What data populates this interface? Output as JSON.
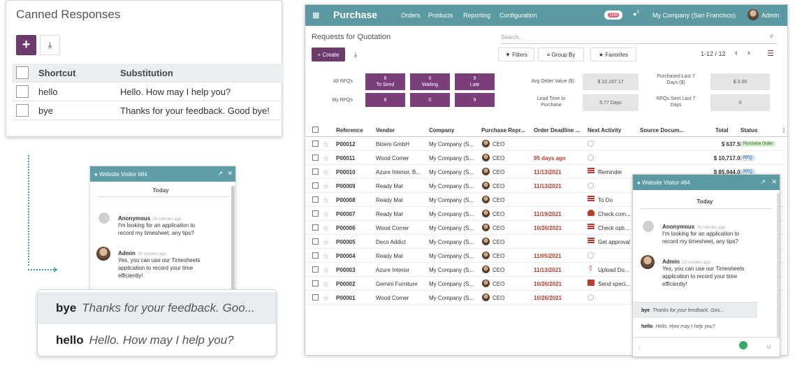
{
  "canned": {
    "title": "Canned Responses",
    "add_label": "+",
    "headers": [
      "Shortcut",
      "Substitution"
    ],
    "rows": [
      {
        "shortcut": "hello",
        "substitution": "Hello. How may I help you?"
      },
      {
        "shortcut": "bye",
        "substitution": "Thanks for your feedback. Good bye!"
      }
    ]
  },
  "left_chat": {
    "title": "Website Visitor #84",
    "today": "Today",
    "messages": [
      {
        "name": "Anonymous",
        "time": "26 minutes ago",
        "text": [
          "I'm looking for an application to",
          "record my timesheet, any tips?"
        ]
      },
      {
        "name": "Admin",
        "time": "26 minutes ago",
        "text": [
          "Yes, you can use our Timesheets",
          "application to record your time",
          "efficiently!"
        ]
      }
    ]
  },
  "left_suggestions": [
    {
      "shortcut": "bye",
      "text": "Thanks for your feedback. Goo..."
    },
    {
      "shortcut": "hello",
      "text": "Hello. How may I help you?"
    }
  ],
  "topbar": {
    "app": "Purchase",
    "menus": [
      "Orders",
      "Products",
      "Reporting",
      "Configuration"
    ],
    "activity_count": "106",
    "message_count": "5",
    "company": "My Company (San Francisco)",
    "user": "Admin"
  },
  "control": {
    "breadcrumb": "Requests for Quotation",
    "search_placeholder": "Search...",
    "create_label": "+ Create",
    "filters_label": "Filters",
    "groupby_label": "Group By",
    "favorites_label": "Favorites",
    "pager": "1-12 / 12"
  },
  "dashboard": {
    "all_rfqs_label": "All RFQs",
    "my_rfqs_label": "My RFQs",
    "to_send": {
      "label": "To Send",
      "all": "8",
      "mine": "8"
    },
    "waiting": {
      "label": "Waiting",
      "all": "0",
      "mine": "0"
    },
    "late": {
      "label": "Late",
      "all": "9",
      "mine": "9"
    },
    "avg_order_label": "Avg Order Value ($)",
    "avg_order_value": "$ 22,197.17",
    "lead_time_label": [
      "Lead Time to",
      "Purchase"
    ],
    "lead_time_value": "5.77  Days",
    "purchased_label": [
      "Purchased Last 7",
      "Days ($)"
    ],
    "purchased_value": "$ 0.00",
    "rfqs_sent_label": [
      "RFQs Sent Last 7",
      "Days"
    ],
    "rfqs_sent_value": "0"
  },
  "table": {
    "headers": [
      "Reference",
      "Vendor",
      "Company",
      "Purchase Repr...",
      "Order Deadline ...",
      "Next Activity",
      "Source Docum...",
      "Total",
      "Status"
    ],
    "rows": [
      {
        "ref": "P00012",
        "vendor": "Bloem GmbH",
        "company": "My Company (S...",
        "rep": "CEO",
        "deadline": "",
        "activity": "",
        "act_icon": "none",
        "total": "$ 637.50",
        "status": "Purchase Order"
      },
      {
        "ref": "P00011",
        "vendor": "Wood Corner",
        "company": "My Company (S...",
        "rep": "CEO",
        "deadline": "95 days ago",
        "activity": "",
        "act_icon": "none",
        "total": "$ 10,717.00",
        "status": "RFQ"
      },
      {
        "ref": "P00010",
        "vendor": "Azure Interior, B...",
        "company": "My Company (S...",
        "rep": "CEO",
        "deadline": "11/13/2021",
        "activity": "Reminder",
        "act_icon": "list",
        "total": "$ 85,944.00",
        "status": "RFQ"
      },
      {
        "ref": "P00009",
        "vendor": "Ready Mat",
        "company": "My Company (S...",
        "rep": "CEO",
        "deadline": "11/13/2021",
        "activity": "",
        "act_icon": "none",
        "total": "",
        "status": ""
      },
      {
        "ref": "P00008",
        "vendor": "Ready Mat",
        "company": "My Company (S...",
        "rep": "CEO",
        "deadline": "",
        "activity": "To Do",
        "act_icon": "list",
        "total": "",
        "status": ""
      },
      {
        "ref": "P00007",
        "vendor": "Ready Mat",
        "company": "My Company (S...",
        "rep": "CEO",
        "deadline": "11/19/2021",
        "activity": "Check com...",
        "act_icon": "users",
        "total": "",
        "status": ""
      },
      {
        "ref": "P00006",
        "vendor": "Wood Corner",
        "company": "My Company (S...",
        "rep": "CEO",
        "deadline": "10/26/2021",
        "activity": "Check opti...",
        "act_icon": "list",
        "total": "",
        "status": ""
      },
      {
        "ref": "P00005",
        "vendor": "Deco Addict",
        "company": "My Company (S...",
        "rep": "CEO",
        "deadline": "",
        "activity": "Get approval",
        "act_icon": "list",
        "total": "",
        "status": ""
      },
      {
        "ref": "P00004",
        "vendor": "Ready Mat",
        "company": "My Company (S...",
        "rep": "CEO",
        "deadline": "11/05/2021",
        "activity": "",
        "act_icon": "none",
        "total": "",
        "status": ""
      },
      {
        "ref": "P00003",
        "vendor": "Azure Interior",
        "company": "My Company (S...",
        "rep": "CEO",
        "deadline": "11/13/2021",
        "activity": "Upload Do...",
        "act_icon": "upload",
        "total": "",
        "status": ""
      },
      {
        "ref": "P00002",
        "vendor": "Gemini Furniture",
        "company": "My Company (S...",
        "rep": "CEO",
        "deadline": "10/26/2021",
        "activity": "Send speci...",
        "act_icon": "mail",
        "total": "",
        "status": ""
      },
      {
        "ref": "P00001",
        "vendor": "Wood Corner",
        "company": "My Company (S...",
        "rep": "CEO",
        "deadline": "10/26/2021",
        "activity": "",
        "act_icon": "none",
        "total": "",
        "status": ""
      }
    ]
  },
  "right_chat": {
    "title": "Website Visitor #84",
    "today": "Today",
    "messages": [
      {
        "name": "Anonymous",
        "time": "26 minutes ago",
        "text": [
          "I'm looking for an application to",
          "record my timesheet, any tips?"
        ]
      },
      {
        "name": "Admin",
        "time": "22 minutes ago",
        "text": [
          "Yes, you can use our Timesheets",
          "application to record your time",
          "efficiently!"
        ]
      }
    ],
    "suggestions": [
      {
        "shortcut": "bye",
        "text": "Thanks for your feedback. Goo..."
      },
      {
        "shortcut": "hello",
        "text": "Hello. How may I help you?"
      }
    ],
    "input_value": ":"
  },
  "colors": {
    "primary": "#6d3a6d",
    "topbar": "#5c9aa2",
    "late": "#c0392b"
  }
}
